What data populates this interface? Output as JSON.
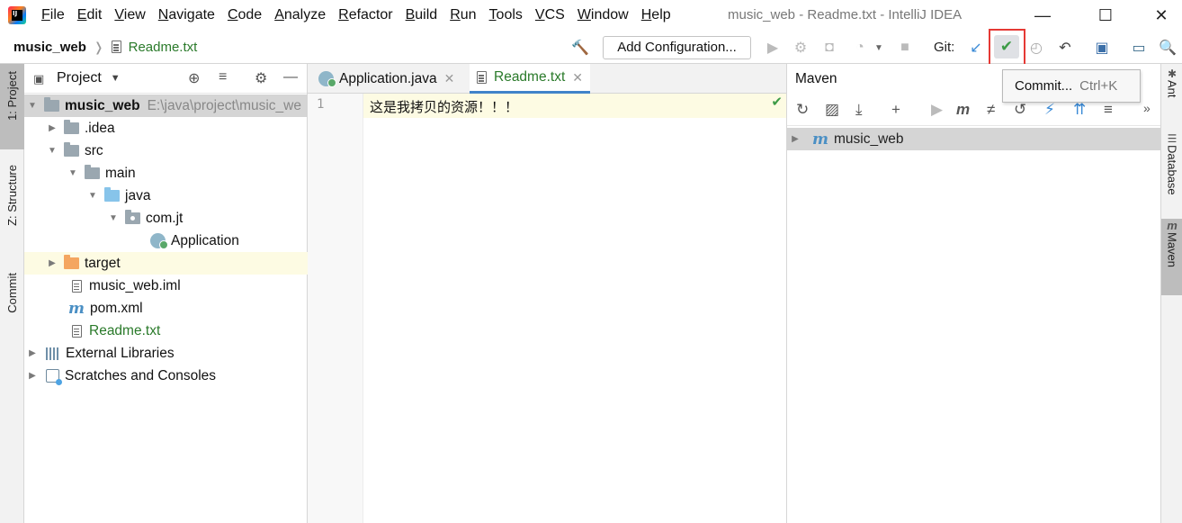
{
  "app": {
    "window_title": "music_web - Readme.txt - IntelliJ IDEA",
    "menu": [
      "File",
      "Edit",
      "View",
      "Navigate",
      "Code",
      "Analyze",
      "Refactor",
      "Build",
      "Run",
      "Tools",
      "VCS",
      "Window",
      "Help"
    ]
  },
  "navbar": {
    "project": "music_web",
    "file": "Readme.txt",
    "add_configuration": "Add Configuration...",
    "git_label": "Git:"
  },
  "left_strip": {
    "project_tab": "1: Project",
    "structure_tab": "Z: Structure",
    "commit_tab": "Commit"
  },
  "project_panel": {
    "title": "Project",
    "tree": [
      {
        "label": "music_web",
        "path": "E:\\java\\project\\music_we"
      },
      {
        "label": ".idea"
      },
      {
        "label": "src"
      },
      {
        "label": "main"
      },
      {
        "label": "java"
      },
      {
        "label": "com.jt"
      },
      {
        "label": "Application"
      },
      {
        "label": "target"
      },
      {
        "label": "music_web.iml"
      },
      {
        "label": "pom.xml"
      },
      {
        "label": "Readme.txt"
      },
      {
        "label": "External Libraries"
      },
      {
        "label": "Scratches and Consoles"
      }
    ]
  },
  "editor": {
    "tabs": [
      {
        "label": "Application.java"
      },
      {
        "label": "Readme.txt"
      }
    ],
    "line_number": "1",
    "content": "这是我拷贝的资源！！！"
  },
  "maven": {
    "title": "Maven",
    "root": "music_web"
  },
  "right_strip": {
    "ant_tab": "Ant",
    "database_tab": "Database",
    "maven_tab": "Maven"
  },
  "tooltip": {
    "label": "Commit...",
    "shortcut": "Ctrl+K"
  },
  "colors": {
    "accent_green": "#3c9b46",
    "highlight_red": "#e53935",
    "tab_underline": "#4083c9"
  }
}
